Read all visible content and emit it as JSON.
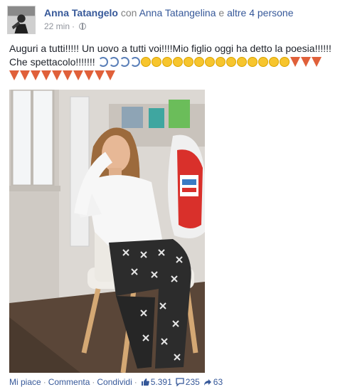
{
  "post": {
    "author": "Anna Tatangelo",
    "with_word": "con",
    "tagged": "Anna Tatangelina",
    "and_word": "e",
    "others": "altre 4 persone",
    "time": "22 min",
    "dot": "·",
    "text_line1": "Auguri a tutti!!!!! Un uovo a tutti voi!!!!Mio figlio oggi ha detto la poesia!!!!!!",
    "text_line2": "Che spettacolo!!!!!!!"
  },
  "emoji": {
    "line2_moons": 4,
    "line2_faces": 14,
    "line2_parties": 3,
    "line3_parties": 10
  },
  "footer": {
    "like": "Mi piace",
    "comment": "Commenta",
    "share": "Condividi",
    "sep": "·",
    "likes_count": "5.391",
    "comments_count": "235",
    "shares_count": "63"
  },
  "colors": {
    "link": "#365899",
    "muted": "#90949c",
    "text": "#1d2129"
  }
}
